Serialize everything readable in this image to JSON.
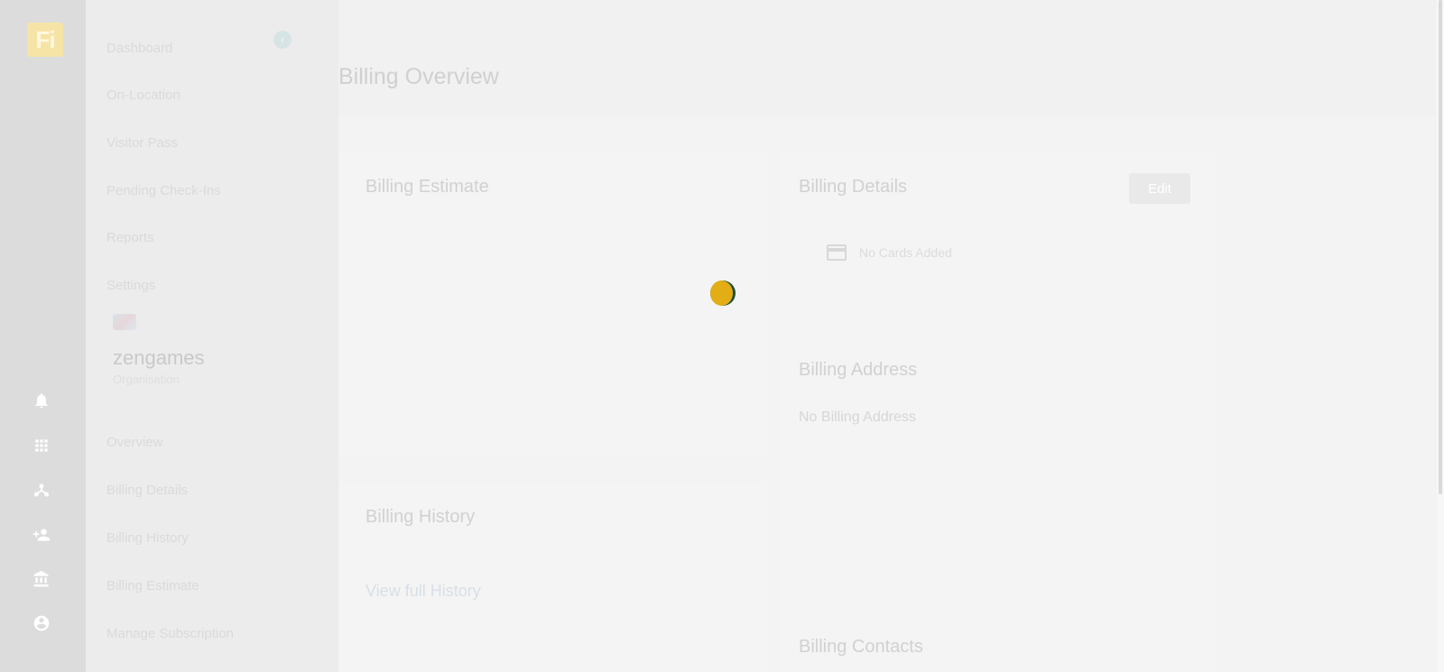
{
  "rail": {
    "logo_text": "Fi",
    "icons": [
      "bell-icon",
      "apps-grid-icon",
      "hierarchy-icon",
      "add-user-icon",
      "bank-icon",
      "account-icon"
    ]
  },
  "nav": {
    "top_items": [
      {
        "label": "Dashboard"
      },
      {
        "label": "On-Location"
      },
      {
        "label": "Visitor Pass"
      },
      {
        "label": "Pending Check-Ins"
      },
      {
        "label": "Reports"
      },
      {
        "label": "Settings"
      }
    ],
    "organization": {
      "name": "zengames",
      "type": "Organisation"
    },
    "bottom_items": [
      {
        "label": "Overview"
      },
      {
        "label": "Billing Details"
      },
      {
        "label": "Billing History"
      },
      {
        "label": "Billing Estimate"
      },
      {
        "label": "Manage Subscription"
      }
    ]
  },
  "main": {
    "title": "Billing Overview",
    "estimate": {
      "title": "Billing Estimate"
    },
    "history": {
      "title": "Billing History",
      "view_link": "View full History"
    },
    "details": {
      "title": "Billing Details",
      "edit_label": "Edit",
      "no_cards": "No Cards Added",
      "address_title": "Billing Address",
      "no_address": "No Billing Address",
      "contacts_title": "Billing Contacts"
    }
  },
  "colors": {
    "spinner_primary": "#e2ad15",
    "spinner_secondary": "#1b4d3e",
    "logo_bg": "#f6e4a6"
  }
}
